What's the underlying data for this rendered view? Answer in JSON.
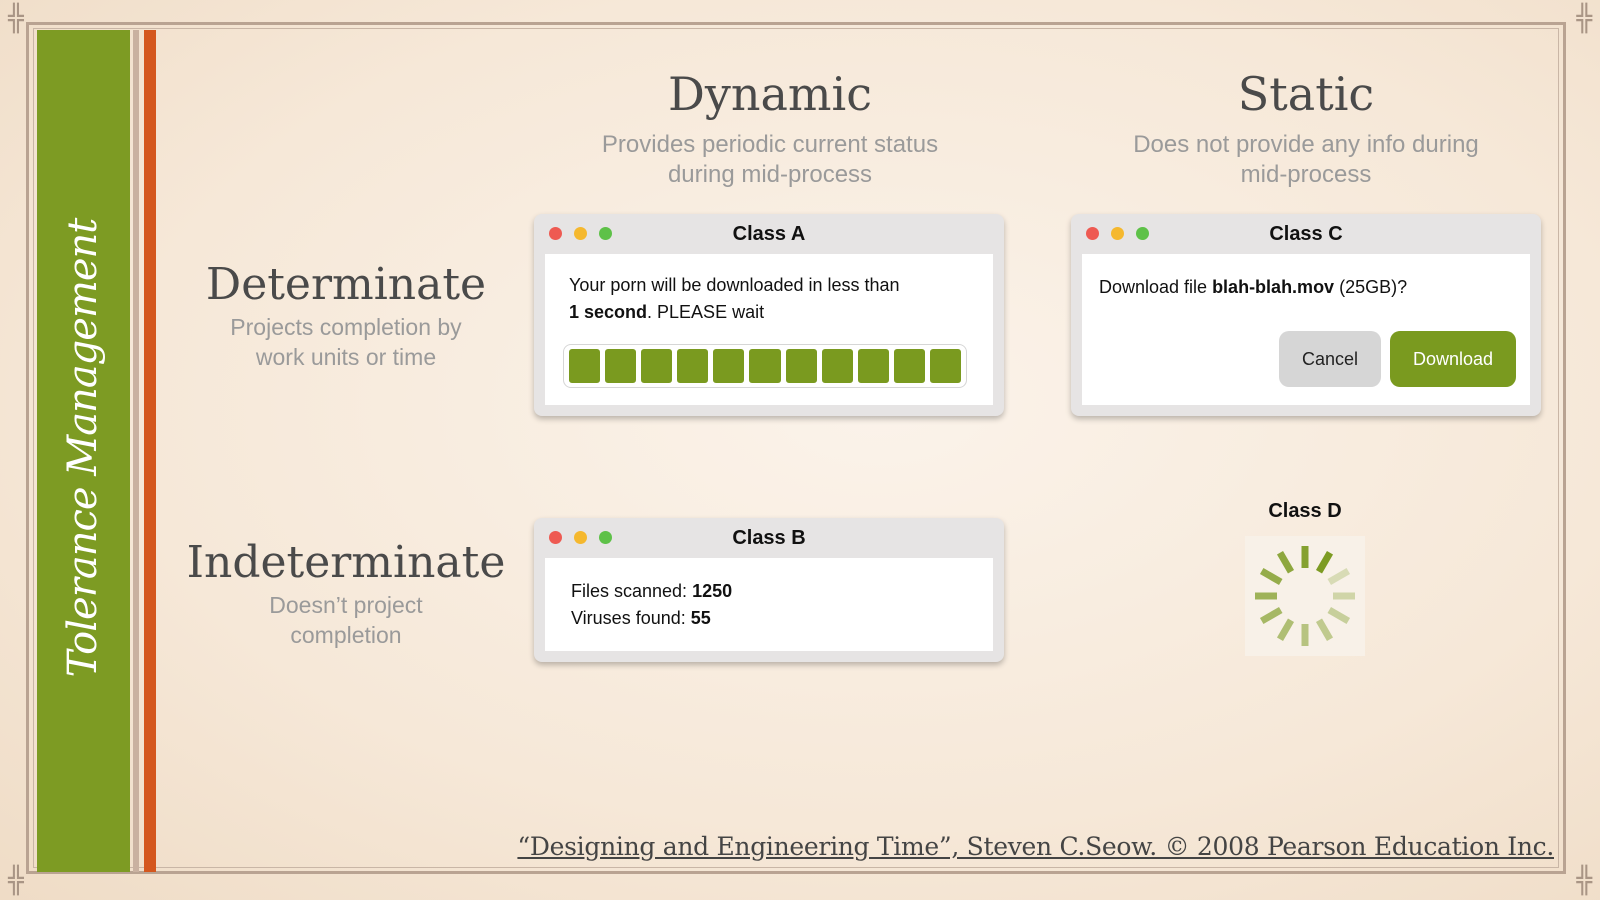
{
  "sidebar": {
    "title": "Tolerance Management"
  },
  "columns": {
    "dynamic": {
      "title": "Dynamic",
      "subtitle_line1": "Provides periodic current status",
      "subtitle_line2": "during mid-process"
    },
    "static": {
      "title": "Static",
      "subtitle_line1": "Does not provide any info during",
      "subtitle_line2": "mid-process"
    }
  },
  "rows": {
    "determinate": {
      "title": "Determinate",
      "subtitle_line1": "Projects completion by",
      "subtitle_line2": "work units or time"
    },
    "indeterminate": {
      "title": "Indeterminate",
      "subtitle_line1": "Doesn’t project",
      "subtitle_line2": "completion"
    }
  },
  "class_a": {
    "title": "Class A",
    "line1": "Your porn will be downloaded in less than",
    "line2_bold": "1 second",
    "line2_rest": ". PLEASE wait",
    "progress_segments_filled": 11,
    "progress_segments_total": 11,
    "progress_color": "#7a9a1f"
  },
  "class_b": {
    "title": "Class B",
    "files_label": "Files scanned: ",
    "files_value": "1250",
    "viruses_label": "Viruses found: ",
    "viruses_value": "55"
  },
  "class_c": {
    "title": "Class C",
    "prompt_prefix": "Download file ",
    "prompt_file": "blah-blah.mov",
    "prompt_suffix": " (25GB)?",
    "cancel_label": "Cancel",
    "download_label": "Download"
  },
  "class_d": {
    "title": "Class D",
    "spinner_icon": "loading-spinner-icon"
  },
  "window_controls": {
    "close_color": "#ee5a52",
    "minimize_color": "#f5b82e",
    "zoom_color": "#5ec148"
  },
  "citation": "“Designing and Engineering Time”, Steven C.Seow. © 2008 Pearson Education Inc.",
  "colors": {
    "accent_green": "#7d9b23",
    "accent_red": "#d4571e"
  }
}
